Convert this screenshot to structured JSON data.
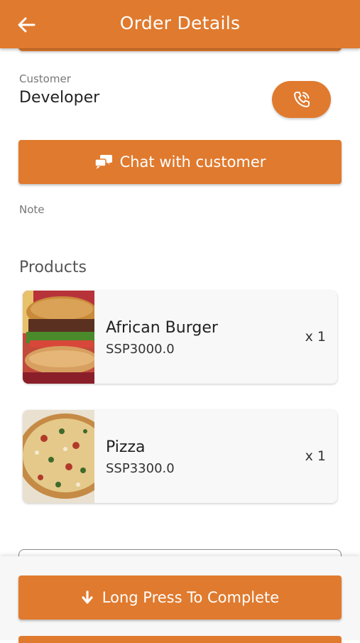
{
  "header": {
    "title": "Order Details",
    "back_icon": "arrow-left-icon",
    "background": "#e07a2e"
  },
  "customer": {
    "label": "Customer",
    "name": "Developer",
    "call_icon": "phone-call-icon"
  },
  "chat_button": {
    "label": "Chat with customer",
    "icon": "chat-bubbles-icon"
  },
  "note": {
    "label": "Note"
  },
  "products": {
    "heading": "Products",
    "items": [
      {
        "name": "African Burger",
        "price": "SSP3000.0",
        "qty": "x 1",
        "image": "burger-image"
      },
      {
        "name": "Pizza",
        "price": "SSP3300.0",
        "qty": "x 1",
        "image": "pizza-image"
      }
    ]
  },
  "complete_button": {
    "label": "Long Press To Complete",
    "icon": "arrow-down-icon"
  },
  "colors": {
    "accent": "#e07a2e",
    "surface": "#f8f8f8"
  }
}
